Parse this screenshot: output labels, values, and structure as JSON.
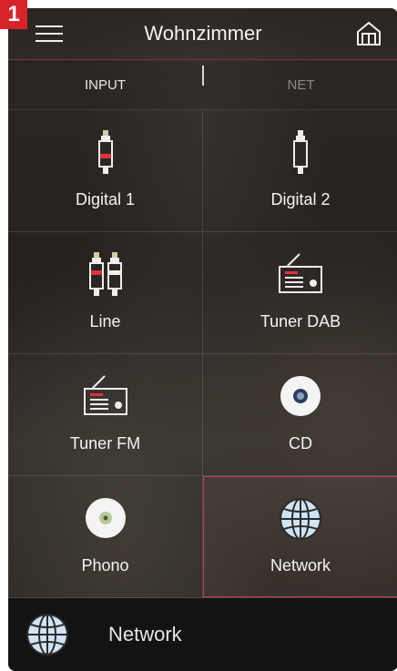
{
  "badge": {
    "number": "1"
  },
  "header": {
    "title": "Wohnzimmer"
  },
  "tabs": [
    {
      "label": "INPUT",
      "active": true
    },
    {
      "label": "NET",
      "active": false
    }
  ],
  "inputs": [
    {
      "label": "Digital 1",
      "icon": "rca-red-plug-icon"
    },
    {
      "label": "Digital 2",
      "icon": "rca-white-plug-icon"
    },
    {
      "label": "Line",
      "icon": "rca-pair-plug-icon"
    },
    {
      "label": "Tuner DAB",
      "icon": "radio-icon"
    },
    {
      "label": "Tuner FM",
      "icon": "radio-icon"
    },
    {
      "label": "CD",
      "icon": "cd-icon"
    },
    {
      "label": "Phono",
      "icon": "vinyl-icon"
    },
    {
      "label": "Network",
      "icon": "globe-icon",
      "selected": true
    }
  ],
  "footer": {
    "current_source": "Network",
    "icon": "globe-icon"
  },
  "colors": {
    "accent": "#d8232a",
    "selection_border": "#d23c5a"
  }
}
